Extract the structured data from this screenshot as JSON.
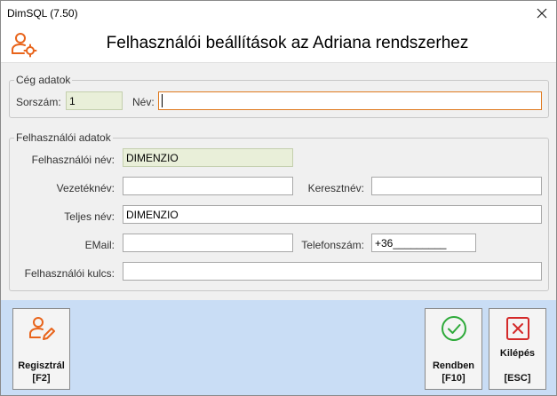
{
  "window": {
    "title": "DimSQL (7.50)"
  },
  "header": {
    "title": "Felhasználói beállítások az Adriana rendszerhez"
  },
  "company": {
    "legend": "Cég adatok",
    "number_label": "Sorszám:",
    "number_value": "1",
    "name_label": "Név:",
    "name_value": ""
  },
  "user": {
    "legend": "Felhasználói adatok",
    "username_label": "Felhasználói név:",
    "username_value": "DIMENZIO",
    "lastname_label": "Vezetéknév:",
    "lastname_value": "",
    "firstname_label": "Keresztnév:",
    "firstname_value": "",
    "fullname_label": "Teljes név:",
    "fullname_value": "DIMENZIO",
    "email_label": "EMail:",
    "email_value": "",
    "phone_label": "Telefonszám:",
    "phone_value": "+36_________",
    "key_label": "Felhasználói kulcs:",
    "key_value": ""
  },
  "buttons": {
    "register_label": "Regisztrál",
    "register_key": "[F2]",
    "ok_label": "Rendben",
    "ok_key": "[F10]",
    "exit_label": "Kilépés",
    "exit_key": "[ESC]"
  },
  "colors": {
    "accent_orange": "#e8641b",
    "ok_green": "#2eaa3a",
    "exit_red": "#d42a2a",
    "footer_blue": "#c9ddf5",
    "readonly_field": "#e9efd9"
  },
  "icons": {
    "header": "user-settings-icon",
    "register": "user-edit-icon",
    "ok": "check-circle-icon",
    "exit": "close-square-icon",
    "titlebar_close": "close-icon"
  }
}
